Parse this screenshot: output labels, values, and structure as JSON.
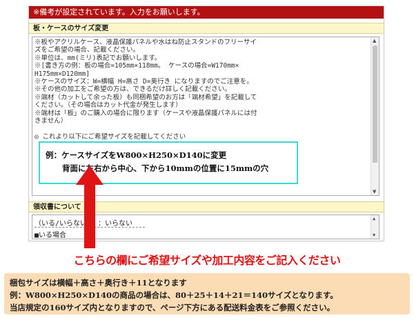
{
  "notice": "※備考が設定されています。入力をお願いします。",
  "sections": {
    "size_header": "板・ケースのサイズ変更",
    "receipt_header": "領収書について"
  },
  "size_textarea": {
    "lines": [
      "※板やアクリルケース、液晶保護パネルや水はね防止スタンドのフリーサイ",
      "ズをご希望の場合、記載ください。",
      "※単位は、mm(ミリ)表記でお願いします。",
      "※[書き方の例：板の場合=105mm×118mm。    ケースの場合=W170mm×",
      "H175mm×D120mm]",
      "※ケースのサイズ：W=横幅  H=高さ  D=奥行き  になりますのでご注意を。",
      "※その他の加工をご希望の方は、できるだけ詳しく記載ください。",
      "※端材（カットして余った板）も同梱希望のお方は「端材希望」を記載して",
      "ください。（その場合はカット代金が発生します）",
      "※端材は「板」のご購入の場合に限ります（ケースや液晶保護パネルには付",
      "きません）",
      "",
      "◎  これより以下にご希望サイズを記載してください"
    ],
    "example_line1": "例：ケースサイズをW800×H250×D140に変更",
    "example_line2": "背面に左右から中心、下から10mmの位置に15mmの穴"
  },
  "receipt_textarea": {
    "line1": "（いる/いらない） ：いらない",
    "line2": "■いる場合"
  },
  "callout": "こちらの欄にご希望サイズや加工内容をご記入ください",
  "info": {
    "line1": "梱包サイズは横幅＋高さ＋奥行き＋11となります",
    "line2": "例：W800×H250×D140の商品の場合は、80＋25＋14＋21＝140サイズとなります。",
    "line3": "当店規定の160サイズ内となりますので、ページ下方にある配送料金表をご参照ください。"
  },
  "colors": {
    "notice_bg": "#b31212",
    "section_bg": "#fdf6c8",
    "example_border": "#3dd6d6",
    "arrow": "#e01414",
    "callout": "#e01414",
    "info_bg": "#fbdcb4"
  }
}
